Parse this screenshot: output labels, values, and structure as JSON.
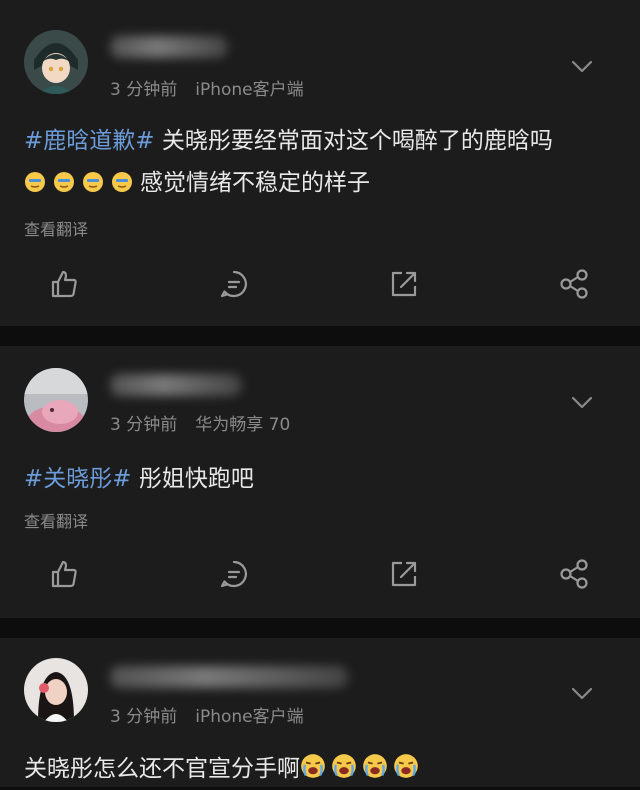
{
  "posts": [
    {
      "time": "3 分钟前",
      "source": "iPhone客户端",
      "topic": "#鹿晗道歉#",
      "text_line1": " 关晓彤要经常面对这个喝醉了的鹿晗吗",
      "text_line2": "感觉情绪不稳定的样子",
      "translate": "查看翻译"
    },
    {
      "time": "3 分钟前",
      "source": "华为畅享 70",
      "topic": "#关晓彤#",
      "text_line1": " 彤姐快跑吧",
      "translate": "查看翻译"
    },
    {
      "time": "3 分钟前",
      "source": "iPhone客户端",
      "text_line1": "关晓彤怎么还不官宣分手啊"
    }
  ],
  "icons": {
    "like": "thumbs-up-icon",
    "comment": "comment-icon",
    "repost": "repost-icon",
    "share": "share-icon",
    "more": "chevron-down-icon"
  },
  "colors": {
    "topic": "#6b9bd8",
    "background": "#1c1c1c"
  }
}
